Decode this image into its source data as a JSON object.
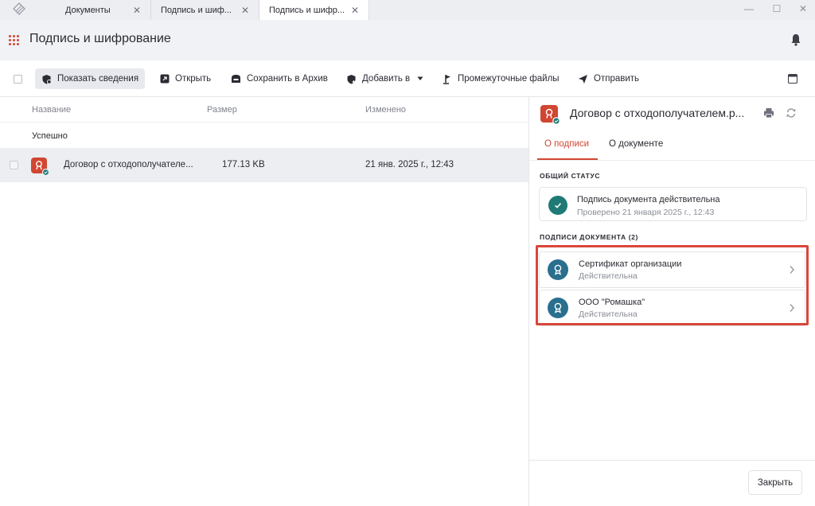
{
  "tabs": [
    {
      "label": "Документы"
    },
    {
      "label": "Подпись и шиф..."
    },
    {
      "label": "Подпись и шифр..."
    }
  ],
  "header": {
    "title": "Подпись и шифрование"
  },
  "toolbar": {
    "show_info": "Показать сведения",
    "open": "Открыть",
    "save_archive": "Сохранить в Архив",
    "add_to": "Добавить в",
    "intermediate": "Промежуточные файлы",
    "send": "Отправить"
  },
  "list": {
    "columns": {
      "name": "Название",
      "size": "Размер",
      "modified": "Изменено"
    },
    "group": "Успешно",
    "rows": [
      {
        "name": "Договор с отходополучателе...",
        "size": "177.13 KB",
        "modified": "21 янв. 2025 г., 12:43"
      }
    ]
  },
  "panel": {
    "title": "Договор с отходополучателем.p...",
    "tabs": {
      "signature": "О подписи",
      "document": "О документе"
    },
    "overall_label": "ОБЩИЙ СТАТУС",
    "status_title": "Подпись документа действительна",
    "status_sub": "Проверено 21 января 2025 г., 12:43",
    "signatures_label": "ПОДПИСИ ДОКУМЕНТА (2)",
    "signatures": [
      {
        "name": "Сертификат организации",
        "state": "Действительна"
      },
      {
        "name": "ООО \"Ромашка\"",
        "state": "Действительна"
      }
    ],
    "close": "Закрыть"
  },
  "colors": {
    "accent": "#d14632",
    "success": "#1e7a75",
    "signer": "#2a6f8e",
    "highlight": "#d9463a"
  }
}
